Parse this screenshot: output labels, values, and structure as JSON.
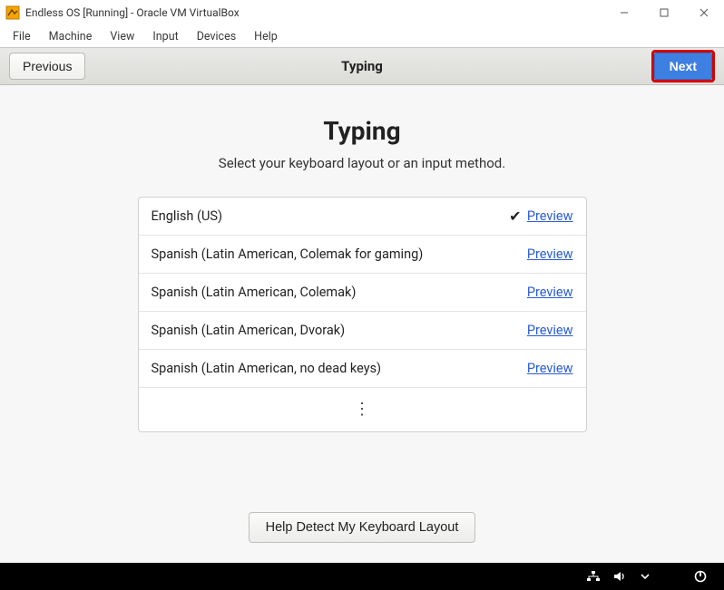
{
  "window": {
    "title": "Endless OS [Running] - Oracle VM VirtualBox"
  },
  "menubar": [
    "File",
    "Machine",
    "View",
    "Input",
    "Devices",
    "Help"
  ],
  "toolbar": {
    "previous_label": "Previous",
    "title": "Typing",
    "next_label": "Next"
  },
  "page": {
    "heading": "Typing",
    "subtitle": "Select your keyboard layout or an input method.",
    "detect_button": "Help Detect My Keyboard Layout"
  },
  "preview_label": "Preview",
  "layouts": [
    {
      "name": "English (US)",
      "selected": true
    },
    {
      "name": "Spanish (Latin American, Colemak for gaming)",
      "selected": false
    },
    {
      "name": "Spanish (Latin American, Colemak)",
      "selected": false
    },
    {
      "name": "Spanish (Latin American, Dvorak)",
      "selected": false
    },
    {
      "name": "Spanish (Latin American, no dead keys)",
      "selected": false
    }
  ]
}
